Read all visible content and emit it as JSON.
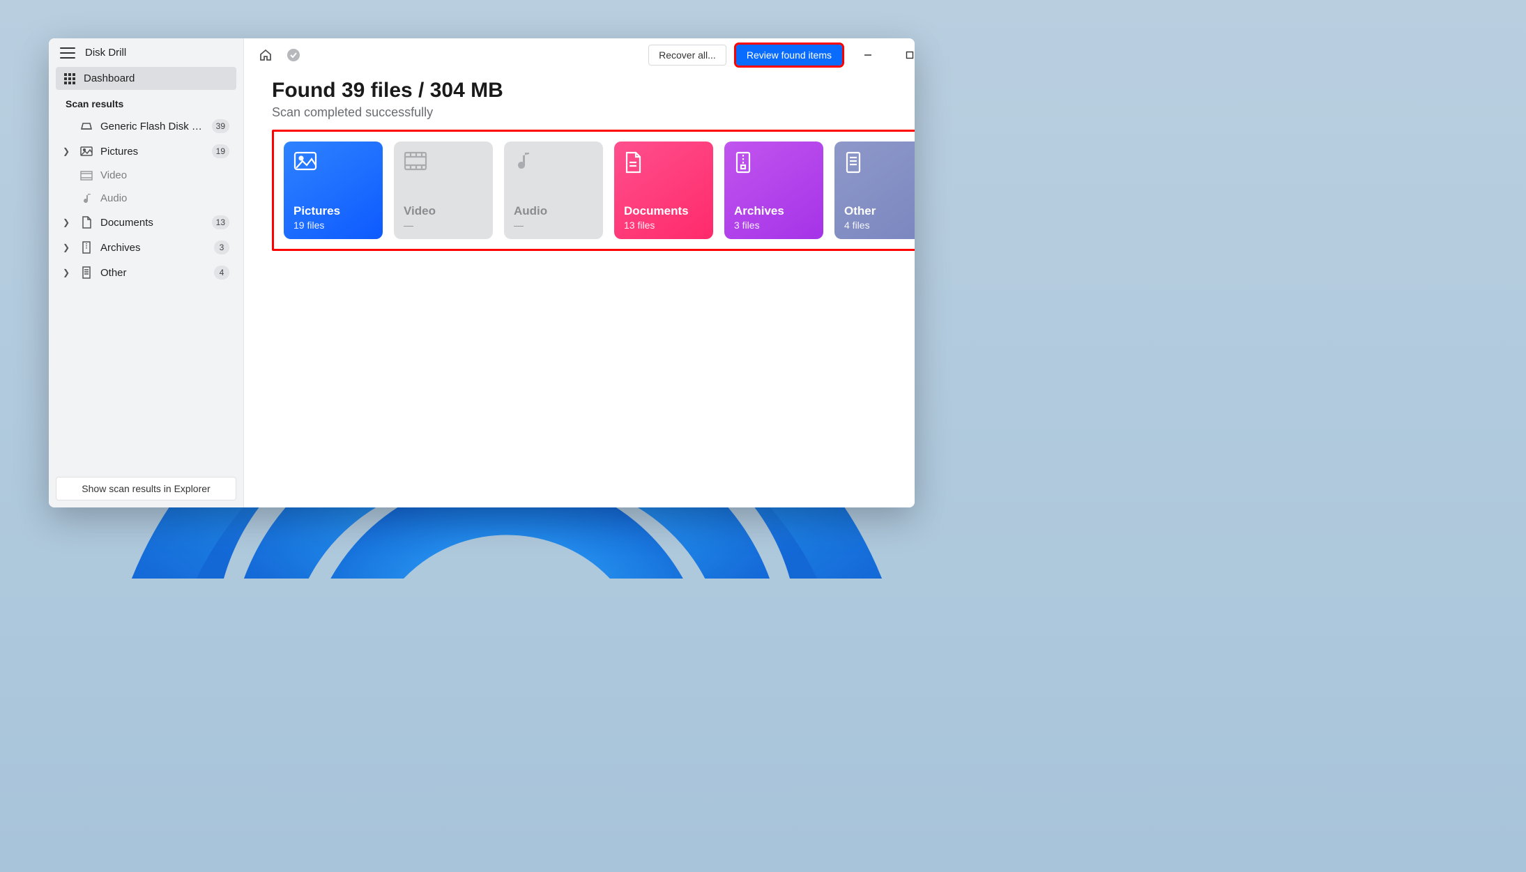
{
  "app": {
    "title": "Disk Drill"
  },
  "sidebar": {
    "dashboard_label": "Dashboard",
    "section_label": "Scan results",
    "device": {
      "label": "Generic Flash Disk USB D...",
      "count": "39"
    },
    "items": [
      {
        "label": "Pictures",
        "count": "19",
        "expandable": true
      },
      {
        "label": "Video",
        "count": "",
        "expandable": false,
        "child": true
      },
      {
        "label": "Audio",
        "count": "",
        "expandable": false,
        "child": true
      },
      {
        "label": "Documents",
        "count": "13",
        "expandable": true
      },
      {
        "label": "Archives",
        "count": "3",
        "expandable": true
      },
      {
        "label": "Other",
        "count": "4",
        "expandable": true
      }
    ],
    "footer_button": "Show scan results in Explorer"
  },
  "topbar": {
    "recover_label": "Recover all...",
    "review_label": "Review found items"
  },
  "headline": "Found 39 files / 304 MB",
  "subline": "Scan completed successfully",
  "cards": {
    "pictures": {
      "title": "Pictures",
      "sub": "19 files"
    },
    "video": {
      "title": "Video",
      "sub": "—"
    },
    "audio": {
      "title": "Audio",
      "sub": "—"
    },
    "documents": {
      "title": "Documents",
      "sub": "13 files"
    },
    "archives": {
      "title": "Archives",
      "sub": "3 files"
    },
    "other": {
      "title": "Other",
      "sub": "4 files"
    }
  }
}
